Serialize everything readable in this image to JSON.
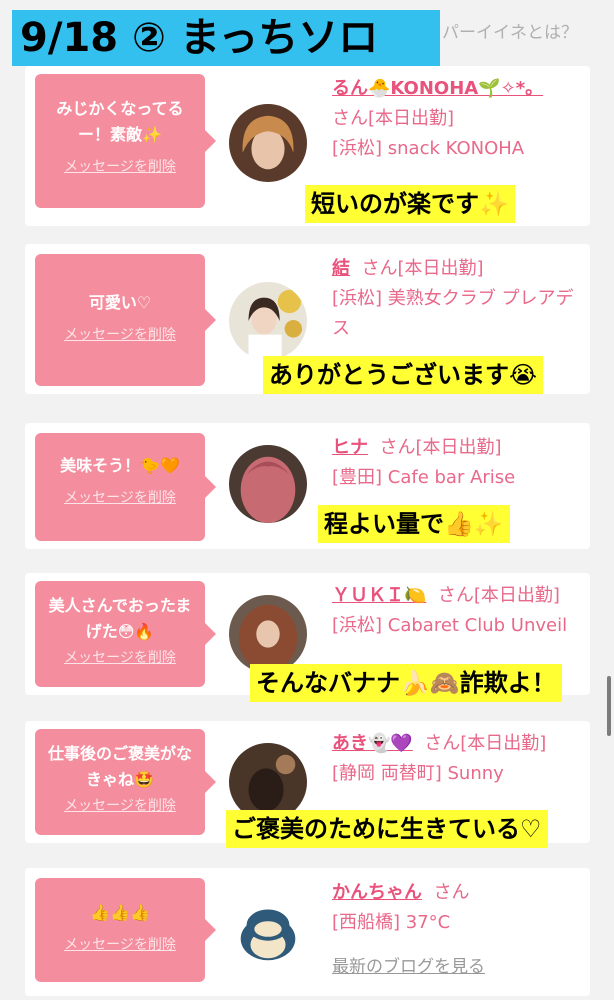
{
  "banner": {
    "title": "9/18 ② まっちソロ",
    "top_link": "パーイイネとは？"
  },
  "entries": [
    {
      "message": "みじかくなってるー！素敵✨",
      "delete_label": "メッセージを削除",
      "name": "るん🐣KONOHA🌱✧*。",
      "san": "さん",
      "status": "[本日出勤]",
      "shop": "[浜松] snack KONOHA",
      "caption": "短いのが楽です✨"
    },
    {
      "message": "可愛い♡",
      "delete_label": "メッセージを削除",
      "name": "結",
      "san": "さん",
      "status": "[本日出勤]",
      "shop": "[浜松] 美熟女クラブ プレアデス",
      "caption": "ありがとうございます😭"
    },
    {
      "message": "美味そう！🐤🧡",
      "delete_label": "メッセージを削除",
      "name": "ヒナ",
      "san": "さん",
      "status": "[本日出勤]",
      "shop": "[豊田] Cafe bar Arise",
      "caption": "程よい量で👍✨"
    },
    {
      "message": "美人さんでおったまげた😳🔥",
      "delete_label": "メッセージを削除",
      "name": "ＹＵＫＩ🍋",
      "san": "さん",
      "status": "[本日出勤]",
      "shop": "[浜松] Cabaret Club Unveil",
      "caption": "そんなバナナ🍌🙈詐欺よ！"
    },
    {
      "message": "仕事後のご褒美がなきゃね🤩",
      "delete_label": "メッセージを削除",
      "name": "あき👻💜",
      "san": "さん",
      "status": "[本日出勤]",
      "shop": "[静岡 両替町] Sunny",
      "caption": "ご褒美のために生きている♡"
    },
    {
      "message": "👍👍👍",
      "delete_label": "メッセージを削除",
      "name": "かんちゃん",
      "san": "さん",
      "status": "",
      "shop": "[西船橋] 37°C",
      "blog": "最新のブログを見る"
    }
  ]
}
